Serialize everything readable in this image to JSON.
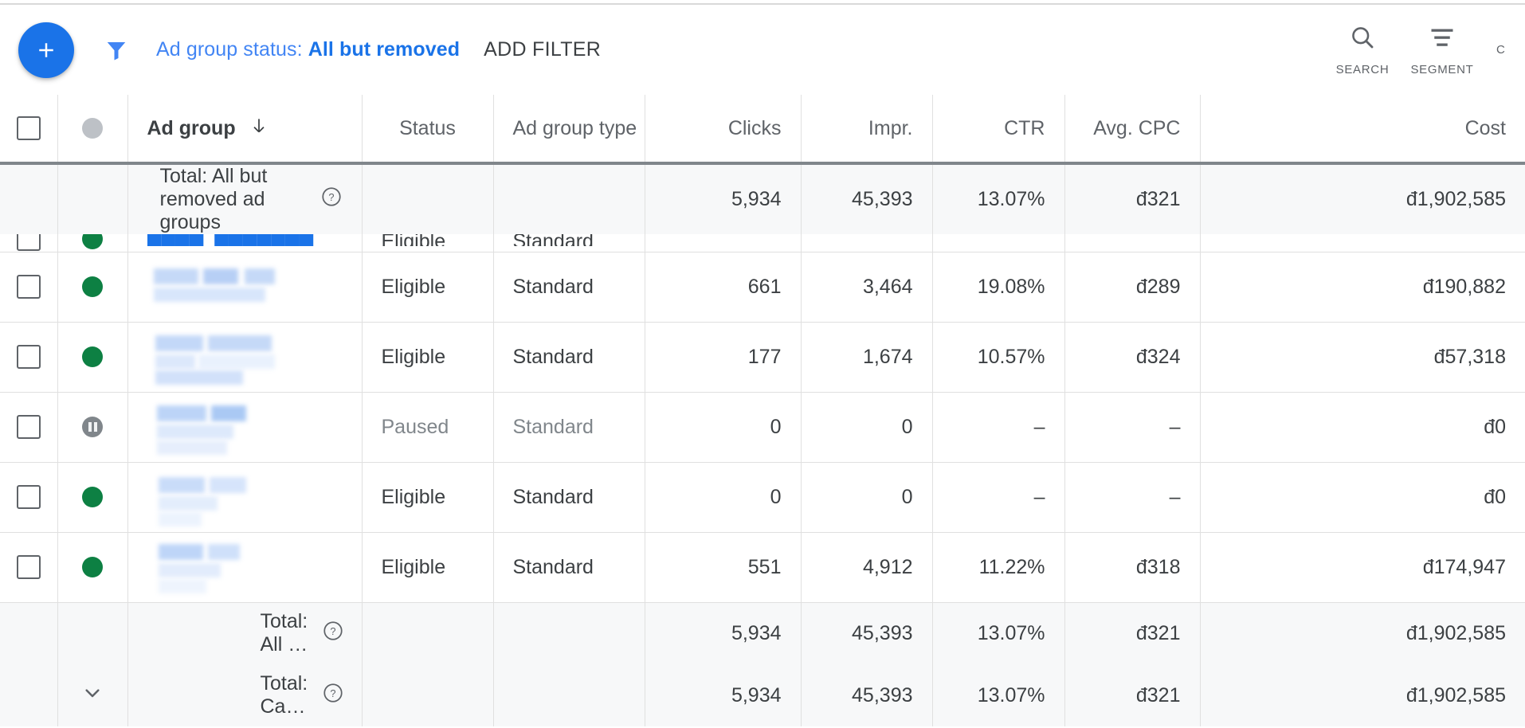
{
  "toolbar": {
    "add_button_icon": "plus-icon",
    "filter_icon": "filter-funnel-icon",
    "filter_chip_label": "Ad group status:",
    "filter_chip_value": "All but removed",
    "add_filter_label": "ADD FILTER",
    "actions": [
      {
        "icon": "search-icon",
        "label": "SEARCH"
      },
      {
        "icon": "segment-icon",
        "label": "SEGMENT"
      },
      {
        "icon": "columns-icon",
        "label": "C"
      }
    ],
    "accent_color": "#1a73e8",
    "link_color": "#4285f4"
  },
  "table": {
    "columns": [
      {
        "key": "checkbox",
        "label": ""
      },
      {
        "key": "status_dot",
        "label": ""
      },
      {
        "key": "ad_group",
        "label": "Ad group",
        "sorted": true,
        "sort_dir": "desc",
        "sort_icon": "arrow-down-icon"
      },
      {
        "key": "status",
        "label": "Status"
      },
      {
        "key": "ad_group_type",
        "label": "Ad group type"
      },
      {
        "key": "clicks",
        "label": "Clicks"
      },
      {
        "key": "impr",
        "label": "Impr."
      },
      {
        "key": "ctr",
        "label": "CTR"
      },
      {
        "key": "avg_cpc",
        "label": "Avg. CPC"
      },
      {
        "key": "cost",
        "label": "Cost"
      }
    ],
    "totals_top": {
      "label": "Total: All but removed ad groups",
      "help_icon": "help-circle-icon",
      "clicks": "5,934",
      "impr": "45,393",
      "ctr": "13.07%",
      "avg_cpc": "đ321",
      "cost": "đ1,902,585"
    },
    "rows": [
      {
        "clipped": true,
        "status_dot": "eligible",
        "name_redacted": false,
        "name_link": true,
        "status": "Eligible",
        "ad_group_type": "Standard",
        "clicks": "",
        "impr": "",
        "ctr": "",
        "avg_cpc": "",
        "cost": ""
      },
      {
        "clipped": false,
        "status_dot": "eligible",
        "name_redacted": true,
        "status": "Eligible",
        "ad_group_type": "Standard",
        "clicks": "661",
        "impr": "3,464",
        "ctr": "19.08%",
        "avg_cpc": "đ289",
        "cost": "đ190,882"
      },
      {
        "clipped": false,
        "status_dot": "eligible",
        "name_redacted": true,
        "status": "Eligible",
        "ad_group_type": "Standard",
        "clicks": "177",
        "impr": "1,674",
        "ctr": "10.57%",
        "avg_cpc": "đ324",
        "cost": "đ57,318"
      },
      {
        "clipped": false,
        "status_dot": "paused",
        "name_redacted": true,
        "status": "Paused",
        "ad_group_type": "Standard",
        "muted": true,
        "clicks": "0",
        "impr": "0",
        "ctr": "–",
        "avg_cpc": "–",
        "cost": "đ0"
      },
      {
        "clipped": false,
        "status_dot": "eligible",
        "name_redacted": true,
        "status": "Eligible",
        "ad_group_type": "Standard",
        "clicks": "0",
        "impr": "0",
        "ctr": "–",
        "avg_cpc": "–",
        "cost": "đ0"
      },
      {
        "clipped": false,
        "status_dot": "eligible",
        "name_redacted": true,
        "status": "Eligible",
        "ad_group_type": "Standard",
        "clicks": "551",
        "impr": "4,912",
        "ctr": "11.22%",
        "avg_cpc": "đ318",
        "cost": "đ174,947"
      }
    ],
    "totals_bottom": [
      {
        "label": "Total: All …",
        "help_icon": "help-circle-icon",
        "expander": false,
        "clicks": "5,934",
        "impr": "45,393",
        "ctr": "13.07%",
        "avg_cpc": "đ321",
        "cost": "đ1,902,585"
      },
      {
        "label": "Total: Ca…",
        "help_icon": "help-circle-icon",
        "expander": true,
        "expander_icon": "chevron-down-icon",
        "clicks": "5,934",
        "impr": "45,393",
        "ctr": "13.07%",
        "avg_cpc": "đ321",
        "cost": "đ1,902,585"
      }
    ]
  },
  "colors": {
    "eligible_green": "#0d8043",
    "paused_gray": "#80868b",
    "row_alt": "#f7f8f9",
    "border": "#e0e0e0"
  }
}
